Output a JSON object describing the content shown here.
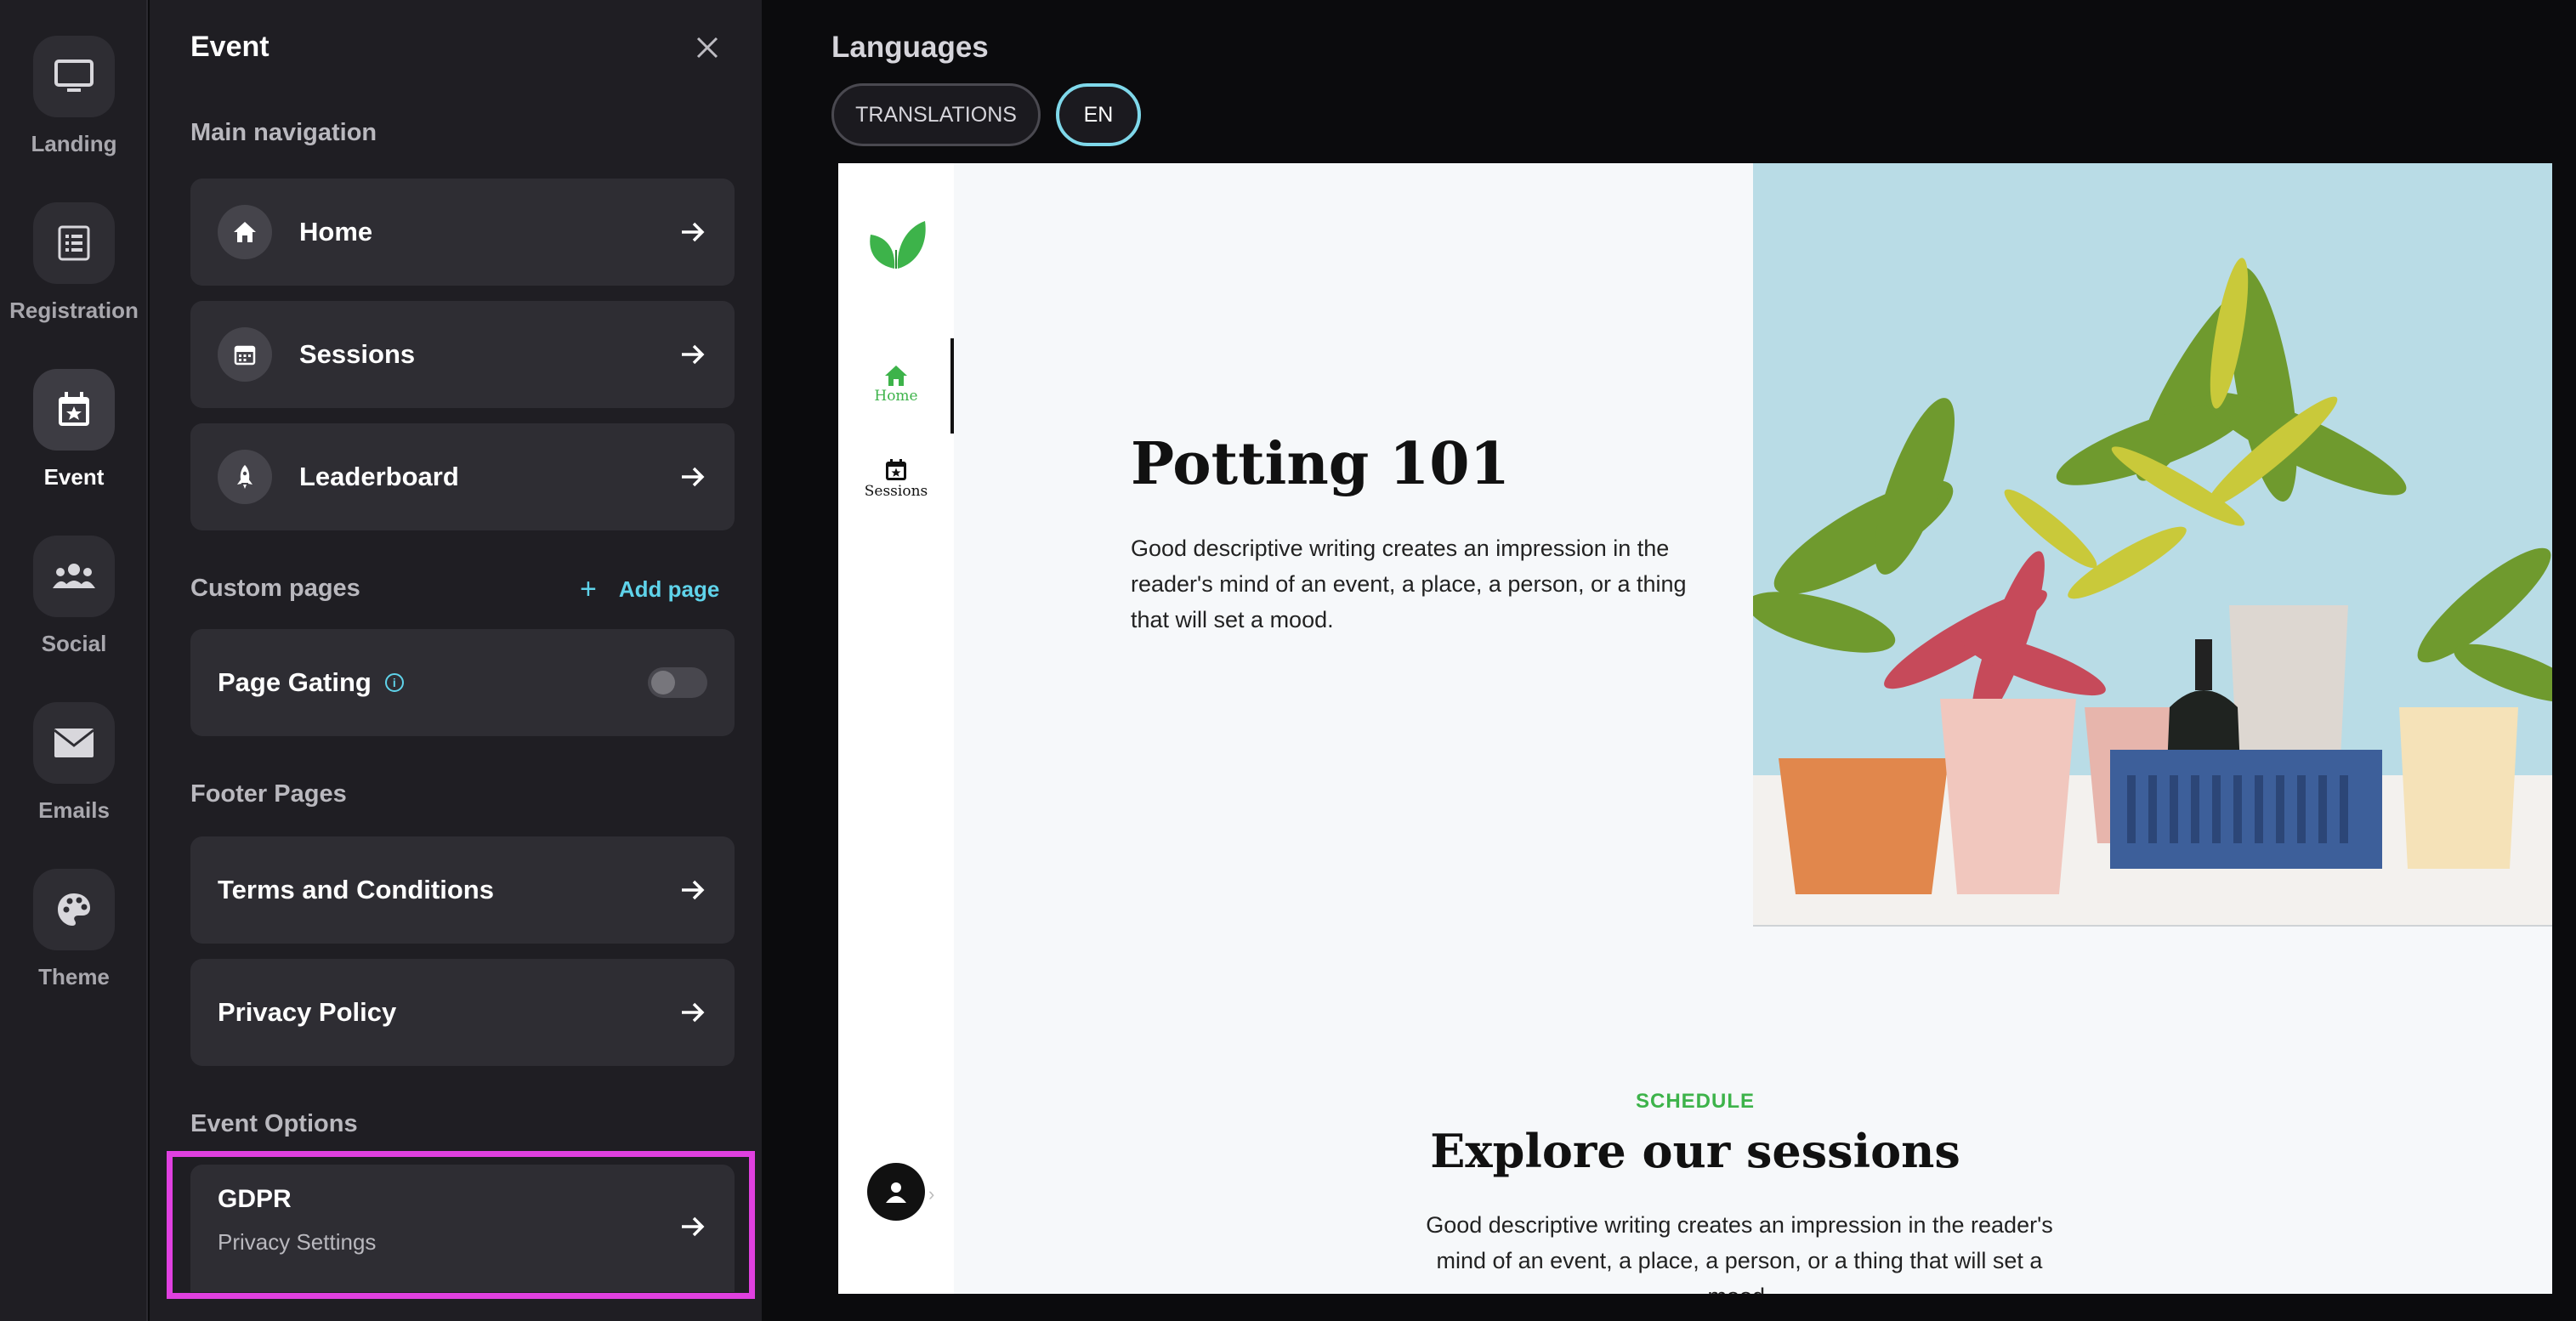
{
  "rail": {
    "items": [
      {
        "label": "Landing",
        "icon": "monitor-icon"
      },
      {
        "label": "Registration",
        "icon": "list-icon"
      },
      {
        "label": "Event",
        "icon": "calendar-star-icon"
      },
      {
        "label": "Social",
        "icon": "users-icon"
      },
      {
        "label": "Emails",
        "icon": "envelope-icon"
      },
      {
        "label": "Theme",
        "icon": "palette-icon"
      }
    ],
    "active": "Event"
  },
  "panel": {
    "title": "Event",
    "main_navigation": {
      "title": "Main navigation",
      "items": [
        {
          "label": "Home",
          "icon": "home-icon"
        },
        {
          "label": "Sessions",
          "icon": "calendar-icon"
        },
        {
          "label": "Leaderboard",
          "icon": "rocket-icon"
        }
      ]
    },
    "custom_pages": {
      "title": "Custom pages",
      "add_label": "Add page",
      "page_gating": {
        "label": "Page Gating",
        "info": "i",
        "enabled": false
      }
    },
    "footer_pages": {
      "title": "Footer Pages",
      "items": [
        {
          "label": "Terms and Conditions"
        },
        {
          "label": "Privacy Policy"
        }
      ]
    },
    "event_options": {
      "title": "Event Options",
      "gdpr": {
        "title": "GDPR",
        "subtitle": "Privacy Settings"
      }
    }
  },
  "languages": {
    "title": "Languages",
    "buttons": [
      {
        "label": "TRANSLATIONS"
      },
      {
        "label": "EN",
        "selected": true
      }
    ]
  },
  "preview": {
    "nav": [
      {
        "label": "Home",
        "active": true
      },
      {
        "label": "Sessions",
        "active": false
      }
    ],
    "hero": {
      "title": "Potting 101",
      "description": "Good descriptive writing creates an impression in the reader's mind of an event, a place, a person, or a thing that will set a mood."
    },
    "schedule": {
      "label": "SCHEDULE",
      "title": "Explore our sessions",
      "description": "Good descriptive writing creates an impression in the reader's mind of an event, a place, a person, or a thing that will set a mood."
    }
  },
  "colors": {
    "accent": "#5fd3ea",
    "highlight": "#e040e0",
    "brand_green": "#3db34a"
  }
}
